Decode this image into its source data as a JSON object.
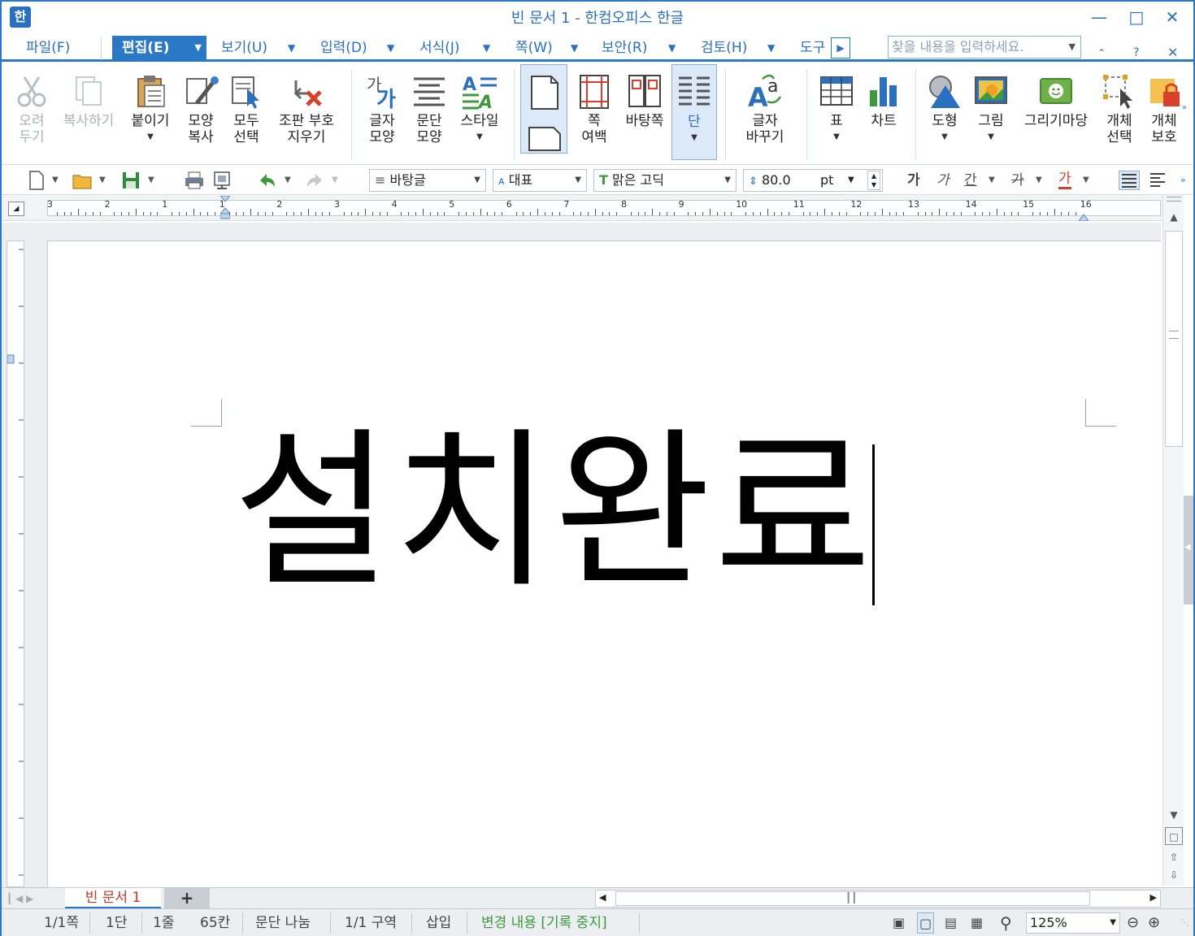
{
  "window": {
    "title": "빈 문서 1 - 한컴오피스 한글",
    "app_icon": "한"
  },
  "menu": {
    "items": [
      {
        "label": "파일(F)"
      },
      {
        "label": "편집(E)"
      },
      {
        "label": "보기(U)"
      },
      {
        "label": "입력(D)"
      },
      {
        "label": "서식(J)"
      },
      {
        "label": "쪽(W)"
      },
      {
        "label": "보안(R)"
      },
      {
        "label": "검토(H)"
      },
      {
        "label": "도구"
      }
    ],
    "search_placeholder": "찾을 내용을 입력하세요."
  },
  "ribbon": {
    "buttons": [
      {
        "label": "오려\n두기"
      },
      {
        "label": "복사하기"
      },
      {
        "label": "붙이기"
      },
      {
        "label": "모양\n복사"
      },
      {
        "label": "모두\n선택"
      },
      {
        "label": "조판 부호\n지우기"
      },
      {
        "label": "글자\n모양"
      },
      {
        "label": "문단\n모양"
      },
      {
        "label": "스타일"
      },
      {
        "label": ""
      },
      {
        "label": "쪽\n여백"
      },
      {
        "label": "바탕쪽"
      },
      {
        "label": "단"
      },
      {
        "label": "글자\n바꾸기"
      },
      {
        "label": "표"
      },
      {
        "label": "차트"
      },
      {
        "label": "도형"
      },
      {
        "label": "그림"
      },
      {
        "label": "그리기마당"
      },
      {
        "label": "개체\n선택"
      },
      {
        "label": "개체\n보호"
      }
    ]
  },
  "format": {
    "style": "바탕글",
    "lang": "대표",
    "font": "맑은 고딕",
    "size": "80.0",
    "unit": "pt",
    "bold": "가",
    "italic": "가",
    "underline": "간",
    "strike": "가",
    "color": "가"
  },
  "ruler": {
    "numbers": [
      "3",
      "2",
      "1",
      "1",
      "2",
      "3",
      "4",
      "5",
      "6",
      "7",
      "8",
      "9",
      "10",
      "11",
      "12",
      "13",
      "14",
      "15",
      "16"
    ]
  },
  "document": {
    "text": "설치완료"
  },
  "tabs": {
    "doc_tab": "빈 문서 1",
    "add": "+"
  },
  "status": {
    "page": "1/1쪽",
    "column": "1단",
    "line": "1줄",
    "col_pos": "65칸",
    "para": "문단 나눔",
    "section": "1/1 구역",
    "mode": "삽입",
    "track": "변경 내용 [기록 중지]",
    "zoom": "125%"
  },
  "colors": {
    "accent": "#2b79c6",
    "title_text": "#2b6fc0",
    "tab_text": "#c0392b",
    "track_text": "#3c9a3c"
  }
}
